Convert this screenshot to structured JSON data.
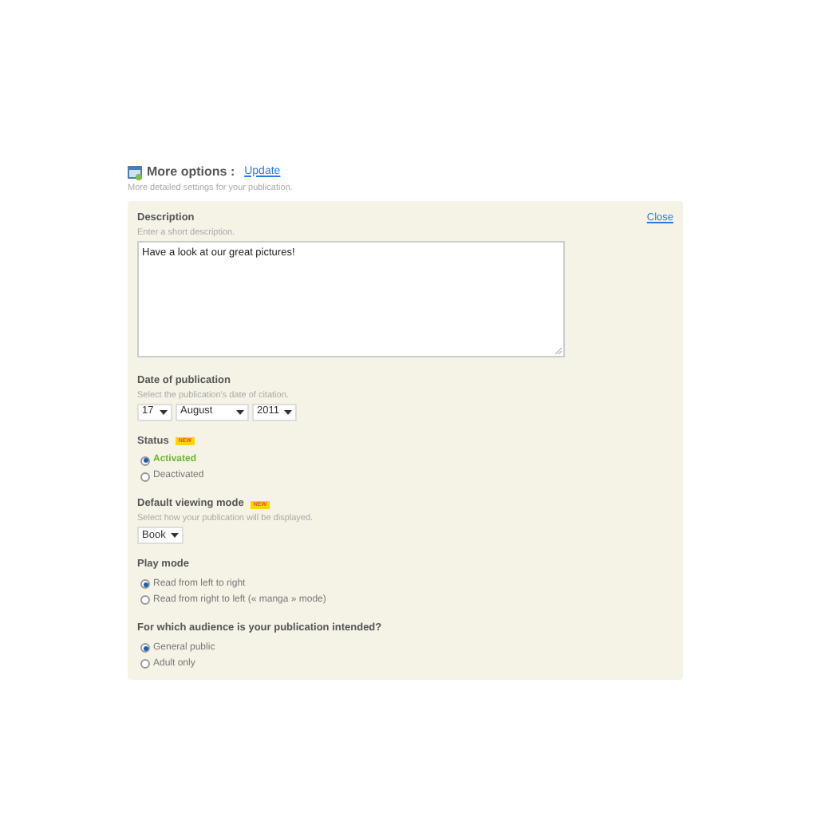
{
  "header": {
    "title": "More options :",
    "update_link": "Update",
    "subtitle": "More detailed settings for your publication."
  },
  "close_link": "Close",
  "sections": [
    {
      "kind": "textarea",
      "label": "Description",
      "hint": "Enter a short description.",
      "value": "Have a look at our great pictures!"
    },
    {
      "kind": "date",
      "label": "Date of publication",
      "hint": "Select the publication's date of citation.",
      "selects": [
        {
          "value": "17"
        },
        {
          "value": "August"
        },
        {
          "value": "2011"
        }
      ]
    },
    {
      "kind": "radio",
      "label": "Status",
      "badge": "NEW",
      "options": [
        {
          "label": "Activated",
          "selected": true
        },
        {
          "label": "Deactivated",
          "selected": false
        }
      ]
    },
    {
      "kind": "select",
      "label": "Default viewing mode",
      "badge": "NEW",
      "hint": "Select how your publication will be displayed.",
      "value": "Book"
    },
    {
      "kind": "radio",
      "label": "Play mode",
      "options": [
        {
          "label": "Read from left to right",
          "selected": true
        },
        {
          "label": "Read from right to left (« manga » mode)",
          "selected": false
        }
      ]
    },
    {
      "kind": "radio",
      "label": "For which audience is your publication intended?",
      "options": [
        {
          "label": "General public",
          "selected": true
        },
        {
          "label": "Adult only",
          "selected": false
        }
      ]
    }
  ]
}
